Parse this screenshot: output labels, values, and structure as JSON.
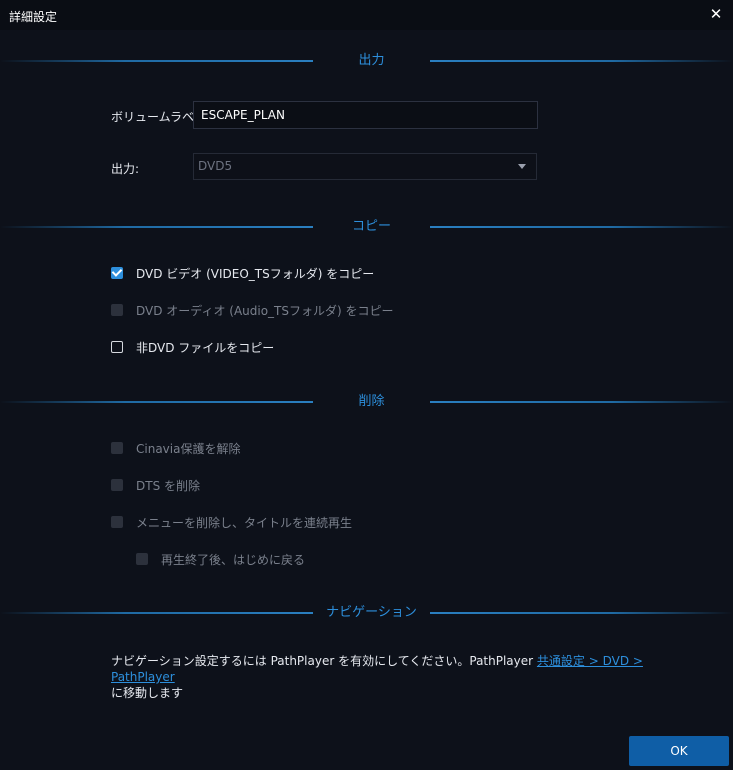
{
  "window": {
    "title": "詳細設定",
    "close_glyph": "✕"
  },
  "sections": {
    "output": "出力",
    "copy": "コピー",
    "remove": "削除",
    "navigation": "ナビゲーション"
  },
  "output": {
    "volume_label_label": "ボリュームラベル:",
    "volume_label_value": "ESCAPE_PLAN",
    "output_label": "出力:",
    "output_selected": "DVD5"
  },
  "copy": {
    "items": [
      {
        "label": "DVD ビデオ (VIDEO_TSフォルダ) をコピー",
        "state": "checked"
      },
      {
        "label": "DVD オーディオ (Audio_TSフォルダ) をコピー",
        "state": "disabled"
      },
      {
        "label": "非DVD ファイルをコピー",
        "state": "unchecked"
      }
    ]
  },
  "remove": {
    "items": [
      {
        "label": "Cinavia保護を解除",
        "state": "disabled"
      },
      {
        "label": "DTS を削除",
        "state": "disabled"
      },
      {
        "label": "メニューを削除し、タイトルを連続再生",
        "state": "disabled"
      },
      {
        "label": "再生終了後、はじめに戻る",
        "state": "disabled"
      }
    ]
  },
  "navigation": {
    "text_before": "ナビゲーション設定するには PathPlayer を有効にしてください。PathPlayer ",
    "link": "共通設定 > DVD > PathPlayer",
    "text_after": "に移動します"
  },
  "footer": {
    "ok_label": "OK"
  },
  "colors": {
    "accent": "#2d8fdc",
    "background": "#0d111a",
    "ok_button": "#0f5ea6"
  }
}
